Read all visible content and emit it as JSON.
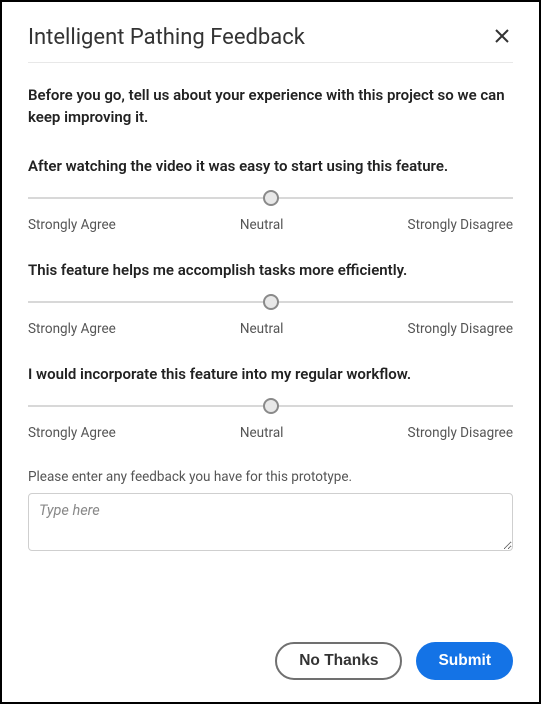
{
  "header": {
    "title": "Intelligent Pathing Feedback"
  },
  "intro": "Before you go, tell us about your experience with this project so we can keep improving it.",
  "questions": [
    {
      "text": "After watching the video it was easy to start using this feature.",
      "labels": {
        "left": "Strongly Agree",
        "center": "Neutral",
        "right": "Strongly Disagree"
      }
    },
    {
      "text": "This feature helps me accomplish tasks more efficiently.",
      "labels": {
        "left": "Strongly Agree",
        "center": "Neutral",
        "right": "Strongly Disagree"
      }
    },
    {
      "text": "I would incorporate this feature into my regular workflow.",
      "labels": {
        "left": "Strongly Agree",
        "center": "Neutral",
        "right": "Strongly Disagree"
      }
    }
  ],
  "feedback": {
    "label": "Please enter any feedback you have for this prototype.",
    "placeholder": "Type here",
    "value": ""
  },
  "footer": {
    "no_thanks_label": "No Thanks",
    "submit_label": "Submit"
  }
}
